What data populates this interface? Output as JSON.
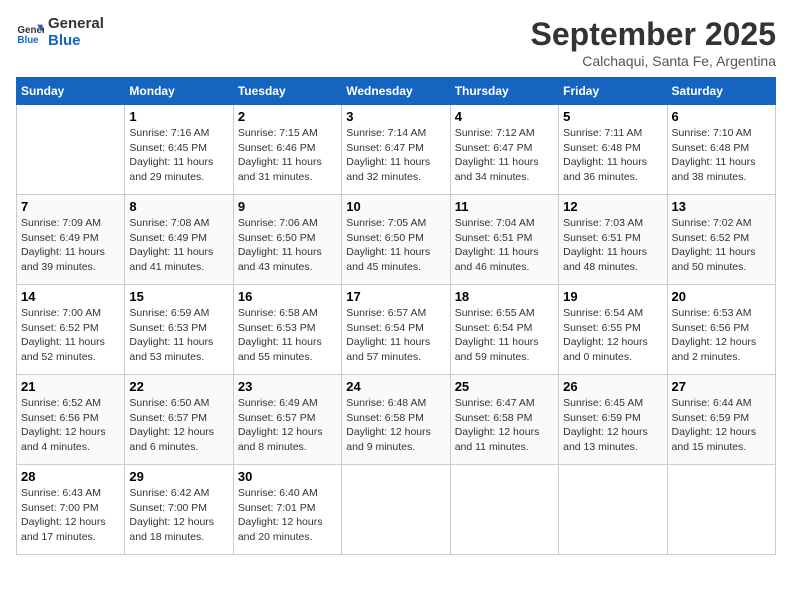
{
  "app": {
    "logo_line1": "General",
    "logo_line2": "Blue"
  },
  "header": {
    "month": "September 2025",
    "location": "Calchaqui, Santa Fe, Argentina"
  },
  "days_of_week": [
    "Sunday",
    "Monday",
    "Tuesday",
    "Wednesday",
    "Thursday",
    "Friday",
    "Saturday"
  ],
  "weeks": [
    [
      {
        "day": "",
        "info": ""
      },
      {
        "day": "1",
        "info": "Sunrise: 7:16 AM\nSunset: 6:45 PM\nDaylight: 11 hours\nand 29 minutes."
      },
      {
        "day": "2",
        "info": "Sunrise: 7:15 AM\nSunset: 6:46 PM\nDaylight: 11 hours\nand 31 minutes."
      },
      {
        "day": "3",
        "info": "Sunrise: 7:14 AM\nSunset: 6:47 PM\nDaylight: 11 hours\nand 32 minutes."
      },
      {
        "day": "4",
        "info": "Sunrise: 7:12 AM\nSunset: 6:47 PM\nDaylight: 11 hours\nand 34 minutes."
      },
      {
        "day": "5",
        "info": "Sunrise: 7:11 AM\nSunset: 6:48 PM\nDaylight: 11 hours\nand 36 minutes."
      },
      {
        "day": "6",
        "info": "Sunrise: 7:10 AM\nSunset: 6:48 PM\nDaylight: 11 hours\nand 38 minutes."
      }
    ],
    [
      {
        "day": "7",
        "info": "Sunrise: 7:09 AM\nSunset: 6:49 PM\nDaylight: 11 hours\nand 39 minutes."
      },
      {
        "day": "8",
        "info": "Sunrise: 7:08 AM\nSunset: 6:49 PM\nDaylight: 11 hours\nand 41 minutes."
      },
      {
        "day": "9",
        "info": "Sunrise: 7:06 AM\nSunset: 6:50 PM\nDaylight: 11 hours\nand 43 minutes."
      },
      {
        "day": "10",
        "info": "Sunrise: 7:05 AM\nSunset: 6:50 PM\nDaylight: 11 hours\nand 45 minutes."
      },
      {
        "day": "11",
        "info": "Sunrise: 7:04 AM\nSunset: 6:51 PM\nDaylight: 11 hours\nand 46 minutes."
      },
      {
        "day": "12",
        "info": "Sunrise: 7:03 AM\nSunset: 6:51 PM\nDaylight: 11 hours\nand 48 minutes."
      },
      {
        "day": "13",
        "info": "Sunrise: 7:02 AM\nSunset: 6:52 PM\nDaylight: 11 hours\nand 50 minutes."
      }
    ],
    [
      {
        "day": "14",
        "info": "Sunrise: 7:00 AM\nSunset: 6:52 PM\nDaylight: 11 hours\nand 52 minutes."
      },
      {
        "day": "15",
        "info": "Sunrise: 6:59 AM\nSunset: 6:53 PM\nDaylight: 11 hours\nand 53 minutes."
      },
      {
        "day": "16",
        "info": "Sunrise: 6:58 AM\nSunset: 6:53 PM\nDaylight: 11 hours\nand 55 minutes."
      },
      {
        "day": "17",
        "info": "Sunrise: 6:57 AM\nSunset: 6:54 PM\nDaylight: 11 hours\nand 57 minutes."
      },
      {
        "day": "18",
        "info": "Sunrise: 6:55 AM\nSunset: 6:54 PM\nDaylight: 11 hours\nand 59 minutes."
      },
      {
        "day": "19",
        "info": "Sunrise: 6:54 AM\nSunset: 6:55 PM\nDaylight: 12 hours\nand 0 minutes."
      },
      {
        "day": "20",
        "info": "Sunrise: 6:53 AM\nSunset: 6:56 PM\nDaylight: 12 hours\nand 2 minutes."
      }
    ],
    [
      {
        "day": "21",
        "info": "Sunrise: 6:52 AM\nSunset: 6:56 PM\nDaylight: 12 hours\nand 4 minutes."
      },
      {
        "day": "22",
        "info": "Sunrise: 6:50 AM\nSunset: 6:57 PM\nDaylight: 12 hours\nand 6 minutes."
      },
      {
        "day": "23",
        "info": "Sunrise: 6:49 AM\nSunset: 6:57 PM\nDaylight: 12 hours\nand 8 minutes."
      },
      {
        "day": "24",
        "info": "Sunrise: 6:48 AM\nSunset: 6:58 PM\nDaylight: 12 hours\nand 9 minutes."
      },
      {
        "day": "25",
        "info": "Sunrise: 6:47 AM\nSunset: 6:58 PM\nDaylight: 12 hours\nand 11 minutes."
      },
      {
        "day": "26",
        "info": "Sunrise: 6:45 AM\nSunset: 6:59 PM\nDaylight: 12 hours\nand 13 minutes."
      },
      {
        "day": "27",
        "info": "Sunrise: 6:44 AM\nSunset: 6:59 PM\nDaylight: 12 hours\nand 15 minutes."
      }
    ],
    [
      {
        "day": "28",
        "info": "Sunrise: 6:43 AM\nSunset: 7:00 PM\nDaylight: 12 hours\nand 17 minutes."
      },
      {
        "day": "29",
        "info": "Sunrise: 6:42 AM\nSunset: 7:00 PM\nDaylight: 12 hours\nand 18 minutes."
      },
      {
        "day": "30",
        "info": "Sunrise: 6:40 AM\nSunset: 7:01 PM\nDaylight: 12 hours\nand 20 minutes."
      },
      {
        "day": "",
        "info": ""
      },
      {
        "day": "",
        "info": ""
      },
      {
        "day": "",
        "info": ""
      },
      {
        "day": "",
        "info": ""
      }
    ]
  ]
}
